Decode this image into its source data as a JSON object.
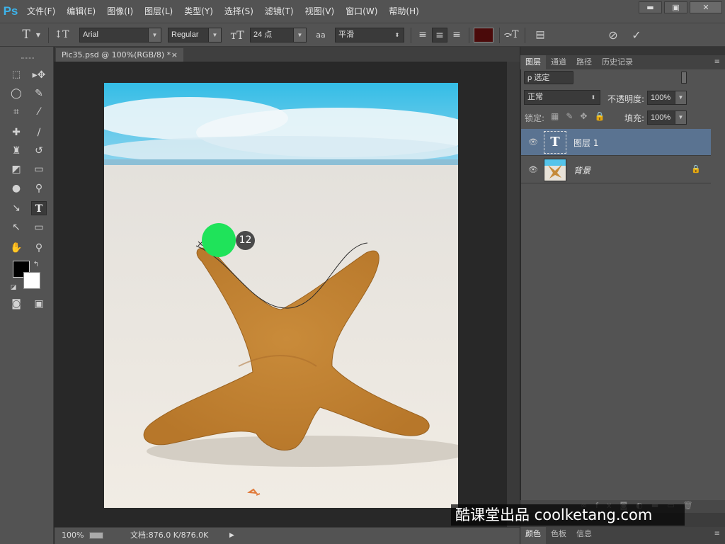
{
  "app": {
    "logo": "Ps"
  },
  "menu": [
    "文件(F)",
    "编辑(E)",
    "图像(I)",
    "图层(L)",
    "类型(Y)",
    "选择(S)",
    "滤镜(T)",
    "视图(V)",
    "窗口(W)",
    "帮助(H)"
  ],
  "window_controls": {
    "minimize": "▬",
    "maximize": "▣",
    "close": "✕"
  },
  "options": {
    "font_family": "Arial",
    "font_style": "Regular",
    "font_size": "24 点",
    "aa_label": "aa",
    "antialias": "平滑",
    "text_color": "#4a0a0a",
    "cancel_icon": "⊘",
    "commit_icon": "✓"
  },
  "document": {
    "tab_title": "Pic35.psd @ 100%(RGB/8) *",
    "tab_close": "×",
    "zoom": "100%",
    "doc_size": "文档:876.0 K/876.0K"
  },
  "cursor_marker": {
    "number": "12",
    "color": "#1fe35a"
  },
  "panels": {
    "tabs": [
      "图层",
      "通道",
      "路径",
      "历史记录"
    ],
    "filter_label": "ρ 选定",
    "blend_mode": "正常",
    "opacity_label": "不透明度:",
    "opacity_value": "100%",
    "lock_label": "锁定:",
    "fill_label": "填充:",
    "fill_value": "100%",
    "layers": [
      {
        "name": "图层 1",
        "type_glyph": "T",
        "selected": true
      },
      {
        "name": "背景",
        "selected": false,
        "locked": true
      }
    ],
    "bottom_tabs": [
      "颜色",
      "色板",
      "信息"
    ]
  },
  "watermark": "酷课堂出品 coolketang.com",
  "colors": {
    "ui_bg": "#535353",
    "selected_layer": "#5a7391",
    "workspace": "#282828"
  }
}
